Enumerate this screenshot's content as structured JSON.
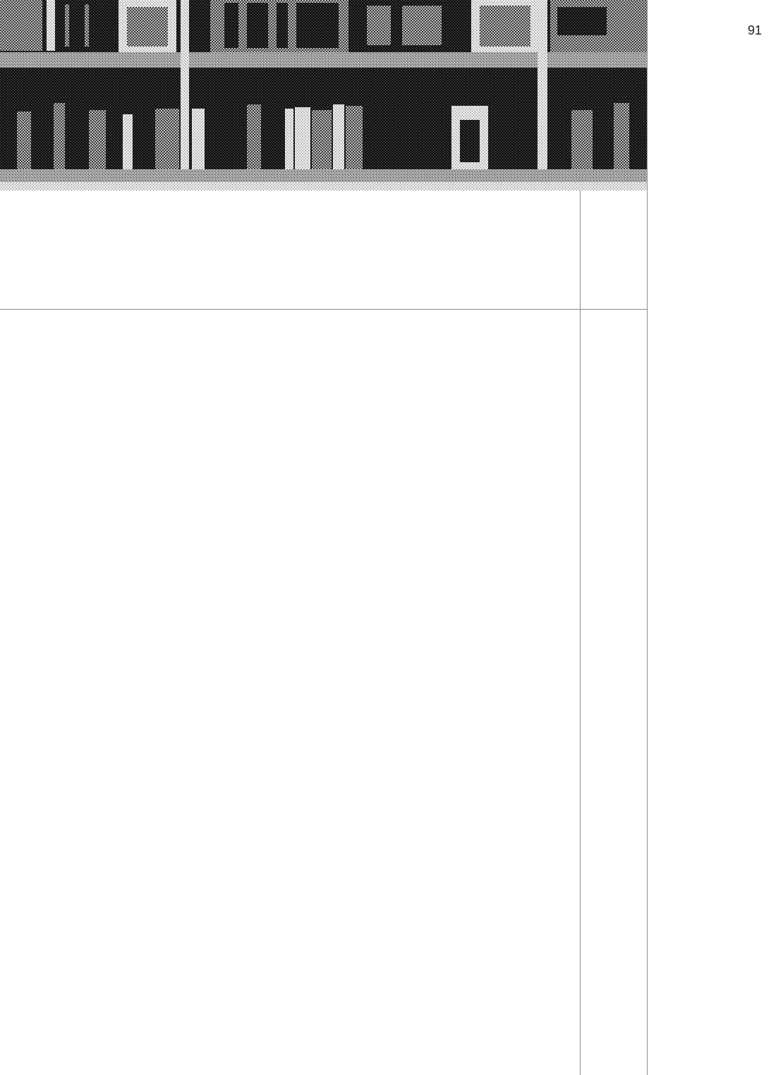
{
  "page": {
    "page_number": "91"
  },
  "photo": {
    "subject": "bookshelf-photo",
    "style": "halftone-dithered",
    "colors": {
      "dark": "#1e1e1e",
      "mid": "#7a7a7a",
      "light": "#d9d9d9"
    }
  },
  "layout_grid": {
    "rule_color": "#8a8a8a"
  }
}
